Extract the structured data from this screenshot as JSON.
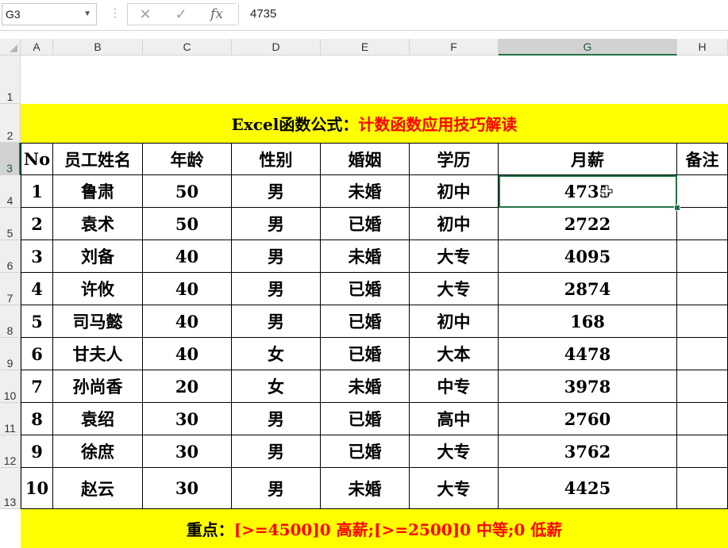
{
  "formula_bar": {
    "name_box": "G3",
    "formula": "4735",
    "cancel_glyph": "✕",
    "enter_glyph": "✓",
    "fx_glyph": "fx"
  },
  "columns": [
    "A",
    "B",
    "C",
    "D",
    "E",
    "F",
    "G",
    "H"
  ],
  "rows": [
    "1",
    "2",
    "3",
    "4",
    "5",
    "6",
    "7",
    "8",
    "9",
    "10",
    "11",
    "12",
    "13"
  ],
  "title": {
    "black": "Excel函数公式：",
    "red": "计数函数应用技巧解读"
  },
  "headers": [
    "No",
    "员工姓名",
    "年龄",
    "性别",
    "婚姻",
    "学历",
    "月薪",
    "备注"
  ],
  "table": [
    [
      "1",
      "鲁肃",
      "50",
      "男",
      "未婚",
      "初中",
      "4735",
      ""
    ],
    [
      "2",
      "袁术",
      "50",
      "男",
      "已婚",
      "初中",
      "2722",
      ""
    ],
    [
      "3",
      "刘备",
      "40",
      "男",
      "未婚",
      "大专",
      "4095",
      ""
    ],
    [
      "4",
      "许攸",
      "40",
      "男",
      "已婚",
      "大专",
      "2874",
      ""
    ],
    [
      "5",
      "司马懿",
      "40",
      "男",
      "已婚",
      "初中",
      "168",
      ""
    ],
    [
      "6",
      "甘夫人",
      "40",
      "女",
      "已婚",
      "大本",
      "4478",
      ""
    ],
    [
      "7",
      "孙尚香",
      "20",
      "女",
      "未婚",
      "中专",
      "3978",
      ""
    ],
    [
      "8",
      "袁绍",
      "30",
      "男",
      "已婚",
      "高中",
      "2760",
      ""
    ],
    [
      "9",
      "徐庶",
      "30",
      "男",
      "已婚",
      "大专",
      "3762",
      ""
    ],
    [
      "10",
      "赵云",
      "30",
      "男",
      "未婚",
      "大专",
      "4425",
      ""
    ]
  ],
  "footer": {
    "black": "重点：",
    "red": "[>=4500]0 高薪;[>=2500]0 中等;0 低薪"
  },
  "colors": {
    "band": "#ffff00",
    "accent": "#217346",
    "emphasis": "#ff0000"
  }
}
